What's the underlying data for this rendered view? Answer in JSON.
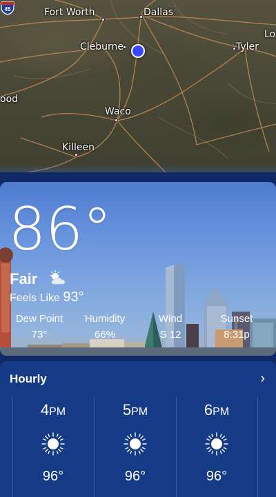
{
  "map": {
    "cities": [
      {
        "name": "Fort Worth",
        "id": "fort-worth"
      },
      {
        "name": "Dallas",
        "id": "dallas"
      },
      {
        "name": "Cleburne",
        "id": "cleburne"
      },
      {
        "name": "Tyler",
        "id": "tyler"
      },
      {
        "name": "Waco",
        "id": "waco"
      },
      {
        "name": "Killeen",
        "id": "killeen"
      },
      {
        "name": "ood",
        "id": "ood"
      },
      {
        "name": "Lo",
        "id": "lo"
      }
    ],
    "highway_shield": "45"
  },
  "current": {
    "temperature": "86°",
    "condition": "Fair",
    "feels_like_label": "Feels Like",
    "feels_like_value": "93°",
    "condition_icon": "partly-sunny-icon"
  },
  "stats": [
    {
      "label": "Dew Point",
      "value": "73°"
    },
    {
      "label": "Humidity",
      "value": "66%"
    },
    {
      "label": "Wind",
      "value": "S 12"
    },
    {
      "label": "Sunset",
      "value": "8:31p"
    }
  ],
  "hourly": {
    "title": "Hourly",
    "chevron": "›",
    "items": [
      {
        "hour": "4",
        "period": "PM",
        "temp": "96°",
        "icon": "sun-icon"
      },
      {
        "hour": "5",
        "period": "PM",
        "temp": "96°",
        "icon": "sun-icon"
      },
      {
        "hour": "6",
        "period": "PM",
        "temp": "96°",
        "icon": "sun-icon"
      }
    ]
  }
}
